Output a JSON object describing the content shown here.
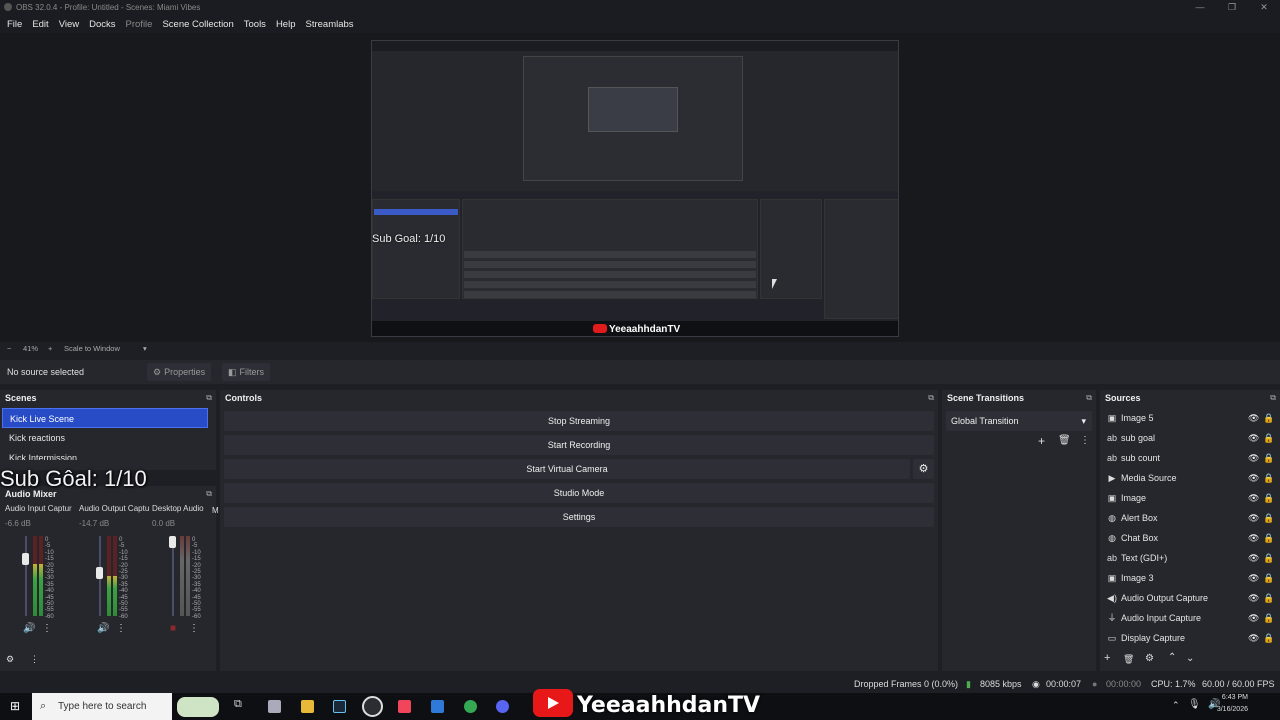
{
  "window": {
    "title": "OBS 32.0.4 - Profile: Untitled - Scenes: Miami Vibes",
    "controls": [
      "—",
      "❐",
      "✕"
    ]
  },
  "menu": [
    "File",
    "Edit",
    "View",
    "Docks",
    "Profile",
    "Scene Collection",
    "Tools",
    "Help",
    "Streamlabs"
  ],
  "preview": {
    "subgoal_text": "Sub Goal: 1/10",
    "channel": "YeeaahhdanTV"
  },
  "zoom": {
    "minus": "−",
    "level": "41%",
    "plus": "+",
    "mode": "Scale to Window"
  },
  "sourcebar": {
    "status": "No source selected",
    "properties": "Properties",
    "filters": "Filters"
  },
  "scenes": {
    "title": "Scenes",
    "items": [
      "Kick Live Scene",
      "Kick reactions",
      "Kick Intermission"
    ]
  },
  "overlay": {
    "subgoal": "Sub Gôal: 1/10"
  },
  "mixer": {
    "title": "Audio Mixer",
    "channels": [
      {
        "name": "Audio Input Captur",
        "db": "-6.6 dB",
        "level": 0.65,
        "fader": 0.75
      },
      {
        "name": "Audio Output Captu",
        "db": "-14.7 dB",
        "level": 0.5,
        "fader": 0.55
      },
      {
        "name": "Desktop Audio",
        "db": "0.0 dB",
        "level": 0.0,
        "fader": 1.0
      }
    ],
    "scale": [
      "0",
      "-5",
      "-10",
      "-15",
      "-20",
      "-25",
      "-30",
      "-35",
      "-40",
      "-45",
      "-50",
      "-55",
      "-60"
    ],
    "extra_label": "M"
  },
  "controls": {
    "title": "Controls",
    "buttons": [
      "Stop Streaming",
      "Start Recording",
      "Start Virtual Camera",
      "Studio Mode",
      "Settings"
    ]
  },
  "transitions": {
    "title": "Scene Transitions",
    "selected": "Global Transition"
  },
  "sources": {
    "title": "Sources",
    "items": [
      {
        "name": "Image 5",
        "icon": "image-icon"
      },
      {
        "name": "sub goal",
        "icon": "text-icon"
      },
      {
        "name": "sub count",
        "icon": "text-icon"
      },
      {
        "name": "Media Source",
        "icon": "play-icon"
      },
      {
        "name": "Image",
        "icon": "image-icon"
      },
      {
        "name": "Alert Box",
        "icon": "browser-icon"
      },
      {
        "name": "Chat Box",
        "icon": "browser-icon"
      },
      {
        "name": "Text (GDI+)",
        "icon": "text-icon"
      },
      {
        "name": "Image 3",
        "icon": "image-icon"
      },
      {
        "name": "Audio Output Capture",
        "icon": "speaker-icon"
      },
      {
        "name": "Audio Input Capture",
        "icon": "mic-icon"
      },
      {
        "name": "Display Capture",
        "icon": "monitor-icon"
      }
    ]
  },
  "status": {
    "dropped": "Dropped Frames 0 (0.0%)",
    "bitrate": "8085 kbps",
    "stream_time": "00:00:07",
    "rec_time": "00:00:00",
    "cpu": "CPU: 1.7%",
    "fps": "60.00 / 60.00 FPS"
  },
  "taskbar": {
    "search_placeholder": "Type here to search",
    "channel": "YeeaahhdanTV",
    "time": "6:43 PM",
    "date": "3/16/2026"
  }
}
